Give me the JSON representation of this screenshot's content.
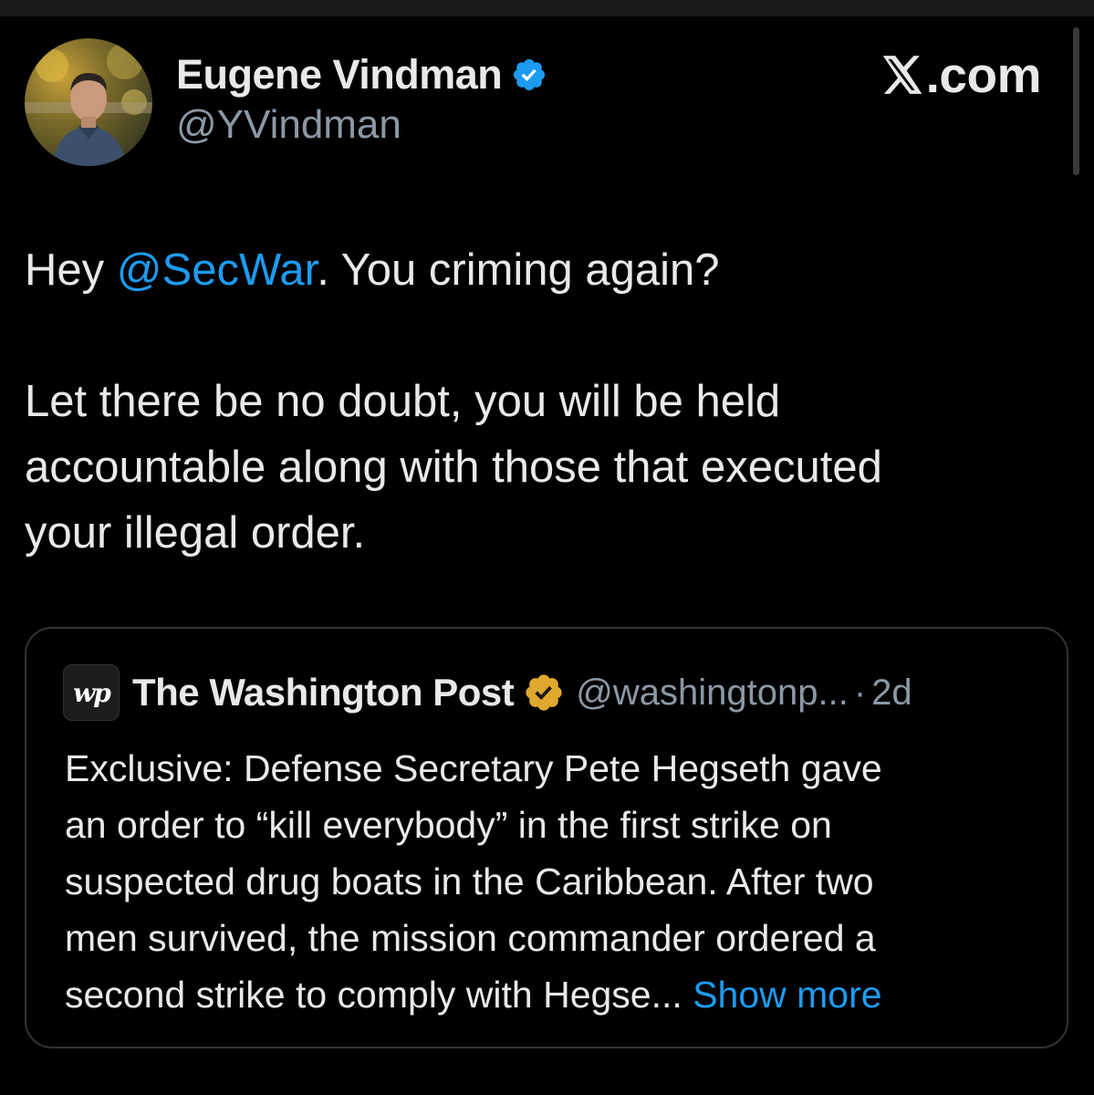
{
  "author": {
    "display_name": "Eugene Vindman",
    "handle": "@YVindman",
    "verified_color": "#1d9bf0"
  },
  "brand": {
    "text": ".com",
    "logo_icon": "x-logo"
  },
  "tweet": {
    "prefix": "Hey ",
    "mention": "@SecWar",
    "suffix": ". You criming again?",
    "line2": "Let there be no doubt, you will be held",
    "line3": "accountable along with those that executed",
    "line4": "your illegal order."
  },
  "quote": {
    "logo_text": "wp",
    "name": "The Washington Post",
    "verified_color": "#e0a82e",
    "handle": "@washingtonp...",
    "separator": "·",
    "time": "2d",
    "lines": [
      "Exclusive: Defense Secretary Pete Hegseth gave",
      "an order to “kill everybody” in the first strike on",
      "suspected drug boats in the Caribbean. After two",
      "men survived, the mission commander ordered a"
    ],
    "last_line": "second strike to comply with Hegse...",
    "show_more": "Show more"
  },
  "colors": {
    "background": "#000000",
    "text": "#e7e9ea",
    "muted": "#8b98a5",
    "link": "#1d9bf0",
    "border": "#2f3336"
  }
}
